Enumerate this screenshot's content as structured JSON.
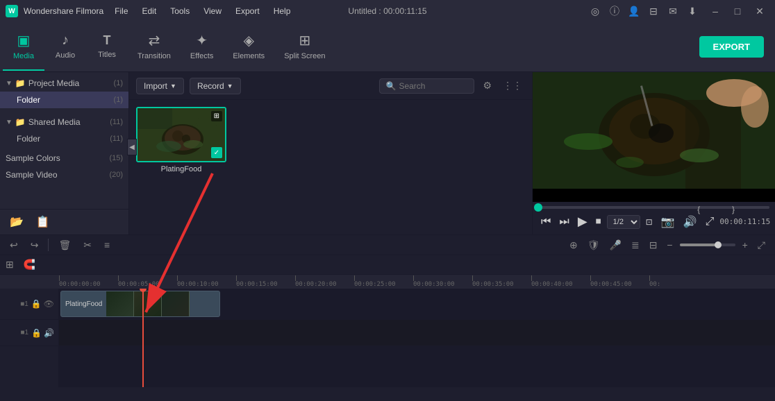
{
  "app": {
    "name": "Wondershare Filmora",
    "title": "Untitled : 00:00:11:15"
  },
  "menus": [
    "File",
    "Edit",
    "Tools",
    "View",
    "Export",
    "Help"
  ],
  "toolbar": {
    "items": [
      {
        "id": "media",
        "label": "Media",
        "icon": "▣",
        "active": true
      },
      {
        "id": "audio",
        "label": "Audio",
        "icon": "♪"
      },
      {
        "id": "titles",
        "label": "Titles",
        "icon": "T"
      },
      {
        "id": "transition",
        "label": "Transition",
        "icon": "⇄"
      },
      {
        "id": "effects",
        "label": "Effects",
        "icon": "✦"
      },
      {
        "id": "elements",
        "label": "Elements",
        "icon": "◈"
      },
      {
        "id": "splitscreen",
        "label": "Split Screen",
        "icon": "⊞"
      }
    ],
    "export_label": "EXPORT"
  },
  "left_panel": {
    "project_media": {
      "label": "Project Media",
      "count": "(1)"
    },
    "folder": {
      "label": "Folder",
      "count": "(1)"
    },
    "shared_media": {
      "label": "Shared Media",
      "count": "(11)"
    },
    "shared_folder": {
      "label": "Folder",
      "count": "(11)"
    },
    "sample_colors": {
      "label": "Sample Colors",
      "count": "(15)"
    },
    "sample_video": {
      "label": "Sample Video",
      "count": "(20)"
    }
  },
  "media_toolbar": {
    "import_label": "Import",
    "record_label": "Record",
    "search_placeholder": "Search"
  },
  "media_item": {
    "name": "PlatingFood",
    "selected": true
  },
  "preview": {
    "time": "00:00:11:15",
    "quality": "1/2"
  },
  "timeline": {
    "ruler": [
      "00:00:00:00",
      "00:00:05:00",
      "00:00:10:00",
      "00:00:15:00",
      "00:00:20:00",
      "00:00:25:00",
      "00:00:30:00",
      "00:00:35:00",
      "00:00:40:00",
      "00:00:45:00",
      "00:"
    ],
    "clip_name": "PlatingFood"
  },
  "winbtns": {
    "minimize": "–",
    "maximize": "□",
    "close": "✕"
  }
}
